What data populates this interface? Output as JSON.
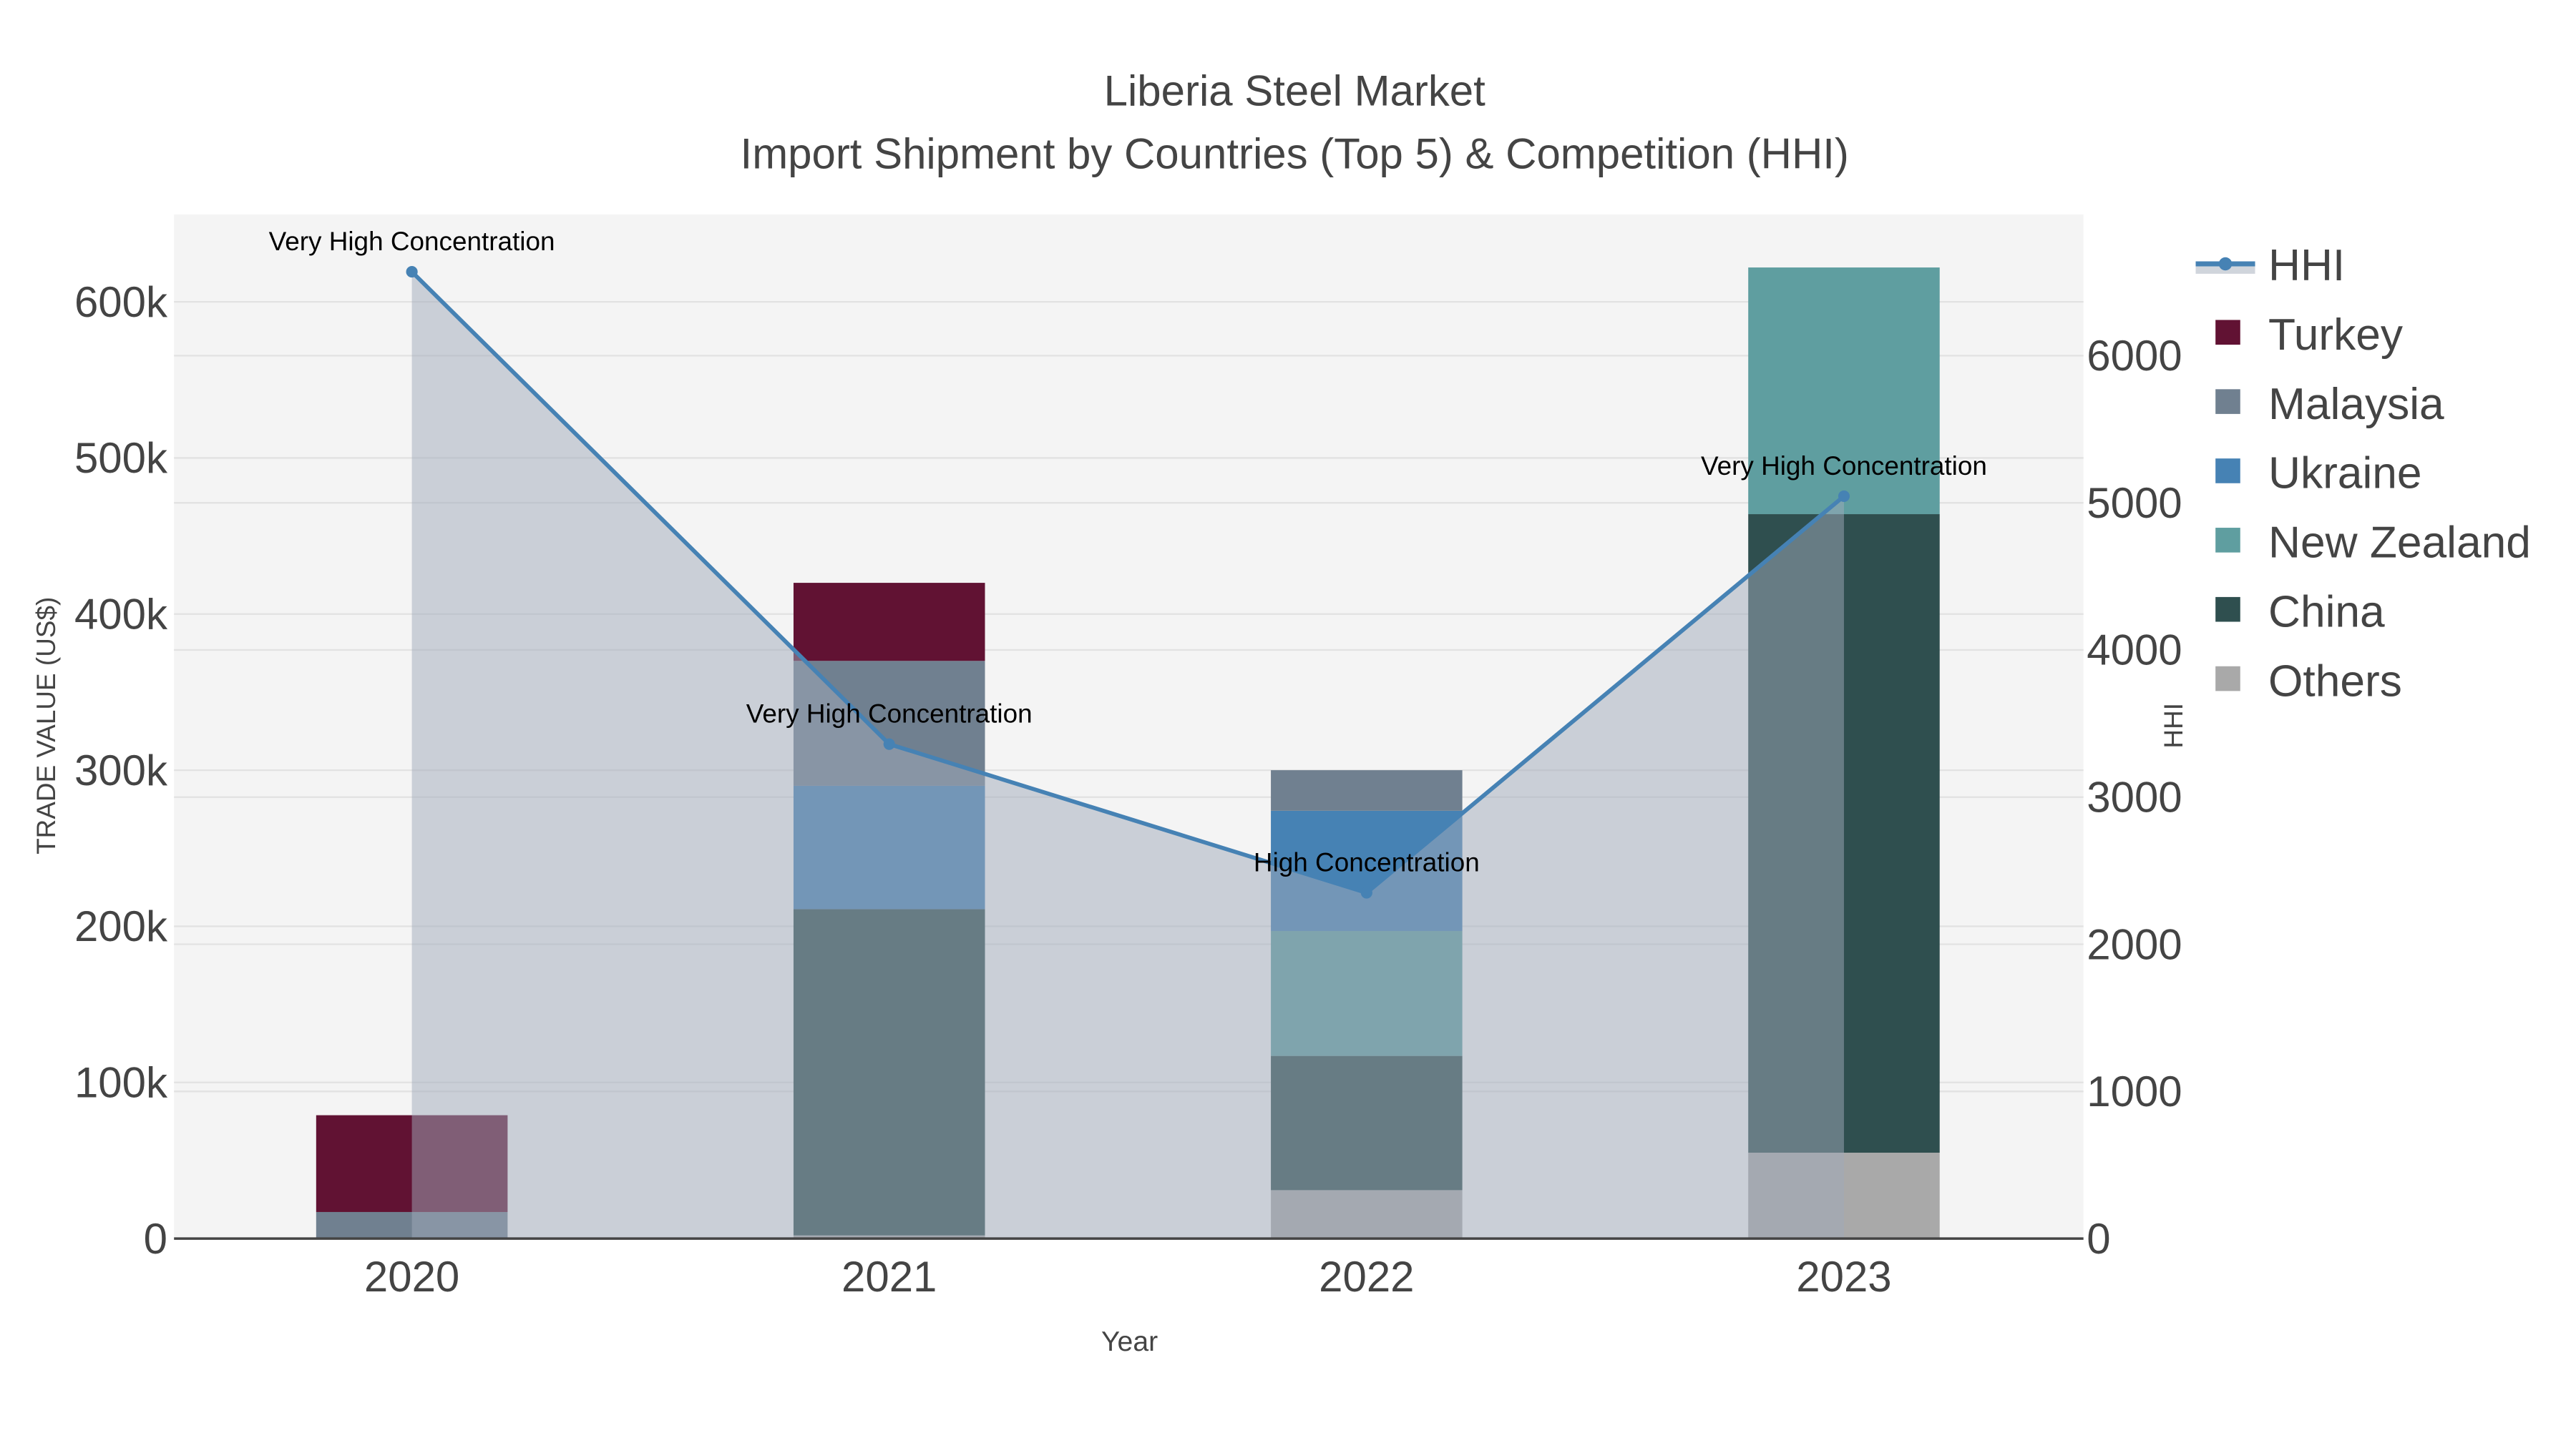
{
  "chart_data": {
    "type": "bar",
    "title": "Liberia Steel Market",
    "subtitle": "Import Shipment by Countries (Top 5) & Competition (HHI)",
    "xlabel": "Year",
    "ylabel": "TRADE VALUE (US$)",
    "y2label": "HHI",
    "categories": [
      "2020",
      "2021",
      "2022",
      "2023"
    ],
    "ylim": [
      0,
      656000
    ],
    "y2lim": [
      0,
      6960
    ],
    "yticks": [
      0,
      100000,
      200000,
      300000,
      400000,
      500000,
      600000
    ],
    "ytick_labels": [
      "0",
      "100k",
      "200k",
      "300k",
      "400k",
      "500k",
      "600k"
    ],
    "y2ticks": [
      0,
      1000,
      2000,
      3000,
      4000,
      5000,
      6000
    ],
    "y2tick_labels": [
      "0",
      "1000",
      "2000",
      "3000",
      "4000",
      "5000",
      "6000"
    ],
    "grid": true,
    "legend_position": "right",
    "series": [
      {
        "name": "Others",
        "color": "#A9A9A9",
        "values": [
          0,
          2000,
          31000,
          55000
        ]
      },
      {
        "name": "China",
        "color": "#2F4F4F",
        "values": [
          0,
          209000,
          86000,
          409000
        ]
      },
      {
        "name": "New Zealand",
        "color": "#5F9EA0",
        "values": [
          0,
          0,
          80000,
          158000
        ]
      },
      {
        "name": "Ukraine",
        "color": "#4682B4",
        "values": [
          0,
          79000,
          77000,
          0
        ]
      },
      {
        "name": "Malaysia",
        "color": "#708090",
        "values": [
          17000,
          80000,
          26000,
          0
        ]
      },
      {
        "name": "Turkey",
        "color": "#611233",
        "values": [
          62000,
          50000,
          0,
          0
        ]
      }
    ],
    "legend_order": [
      "HHI",
      "Turkey",
      "Malaysia",
      "Ukraine",
      "New Zealand",
      "China",
      "Others"
    ],
    "hhi": {
      "name": "HHI",
      "color": "#4682B4",
      "values": [
        6570,
        3360,
        2350,
        5045
      ],
      "annotations": [
        "Very High Concentration",
        "Very High Concentration",
        "High Concentration",
        "Very High Concentration"
      ]
    }
  }
}
